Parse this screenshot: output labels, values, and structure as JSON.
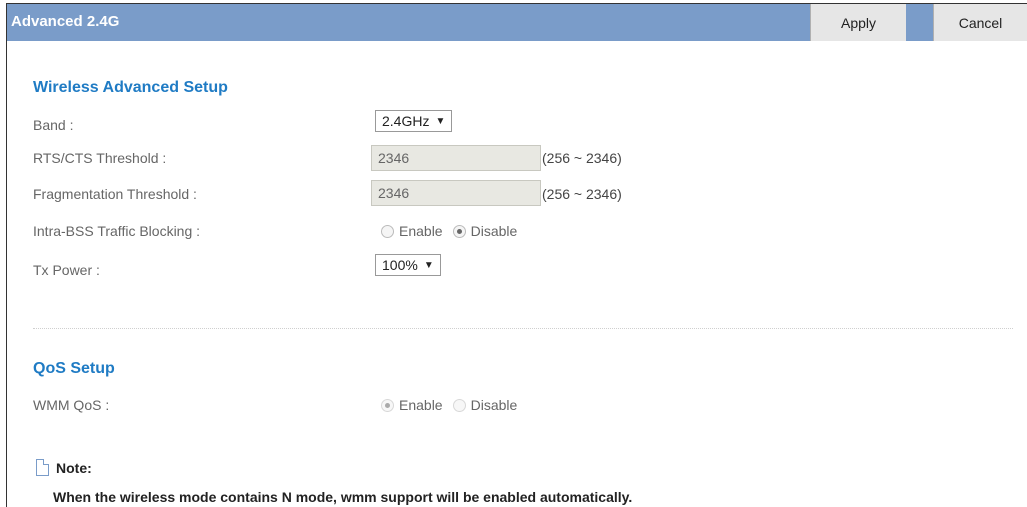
{
  "header": {
    "title": "Advanced 2.4G",
    "apply_label": "Apply",
    "cancel_label": "Cancel"
  },
  "wireless": {
    "section_title": "Wireless Advanced Setup",
    "band": {
      "label": "Band :",
      "value": "2.4GHz"
    },
    "rts": {
      "label": "RTS/CTS Threshold :",
      "value": "2346",
      "range": "(256 ~ 2346)"
    },
    "frag": {
      "label": "Fragmentation Threshold :",
      "value": "2346",
      "range": "(256 ~ 2346)"
    },
    "intra_bss": {
      "label": "Intra-BSS Traffic Blocking :",
      "enable": "Enable",
      "disable": "Disable",
      "selected": "Disable"
    },
    "tx_power": {
      "label": "Tx Power :",
      "value": "100%"
    }
  },
  "qos": {
    "section_title": "QoS Setup",
    "wmm": {
      "label": "WMM QoS :",
      "enable": "Enable",
      "disable": "Disable",
      "selected": "Enable"
    }
  },
  "note": {
    "title": "Note:",
    "text": "When the wireless mode contains N mode, wmm support will be enabled automatically."
  },
  "colors": {
    "header_bg": "#7a9cc9",
    "section_title": "#1f7bc4"
  }
}
